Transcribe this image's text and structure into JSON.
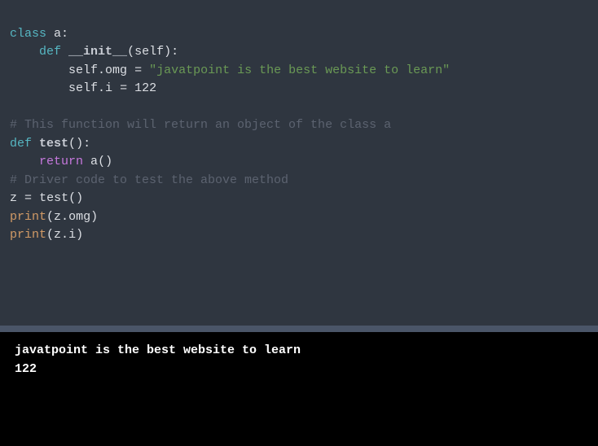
{
  "code": {
    "l1": {
      "kw_class": "class",
      "sp1": " ",
      "name": "a",
      "colon": ":"
    },
    "l2": {
      "indent": "    ",
      "kw_def": "def",
      "sp1": " ",
      "dund": "__init__",
      "paren_o": "(",
      "self": "self",
      "paren_c": ")",
      "colon": ":"
    },
    "l3": {
      "indent": "        ",
      "self": "self",
      "dot": ".",
      "attr": "omg",
      "sp1": " ",
      "eq": "=",
      "sp2": " ",
      "str": "\"javatpoint is the best website to learn\""
    },
    "l4": {
      "indent": "        ",
      "self": "self",
      "dot": ".",
      "attr": "i",
      "sp1": " ",
      "eq": "=",
      "sp2": " ",
      "num": "122"
    },
    "l5": {
      "blank": ""
    },
    "l6": {
      "comment": "# This function will return an object of the class a"
    },
    "l7": {
      "kw_def": "def",
      "sp1": " ",
      "name": "test",
      "paren_o": "(",
      "paren_c": ")",
      "colon": ":"
    },
    "l8": {
      "indent": "    ",
      "kw_return": "return",
      "sp1": " ",
      "call": "a",
      "paren_o": "(",
      "paren_c": ")"
    },
    "l9": {
      "comment": "# Driver code to test the above method"
    },
    "l10": {
      "var": "z",
      "sp1": " ",
      "eq": "=",
      "sp2": " ",
      "call": "test",
      "paren_o": "(",
      "paren_c": ")"
    },
    "l11": {
      "fn": "print",
      "paren_o": "(",
      "var": "z",
      "dot": ".",
      "attr": "omg",
      "paren_c": ")"
    },
    "l12": {
      "fn": "print",
      "paren_o": "(",
      "var": "z",
      "dot": ".",
      "attr": "i",
      "paren_c": ")"
    }
  },
  "output": {
    "line1": "javatpoint is the best website to learn",
    "line2": "122"
  }
}
